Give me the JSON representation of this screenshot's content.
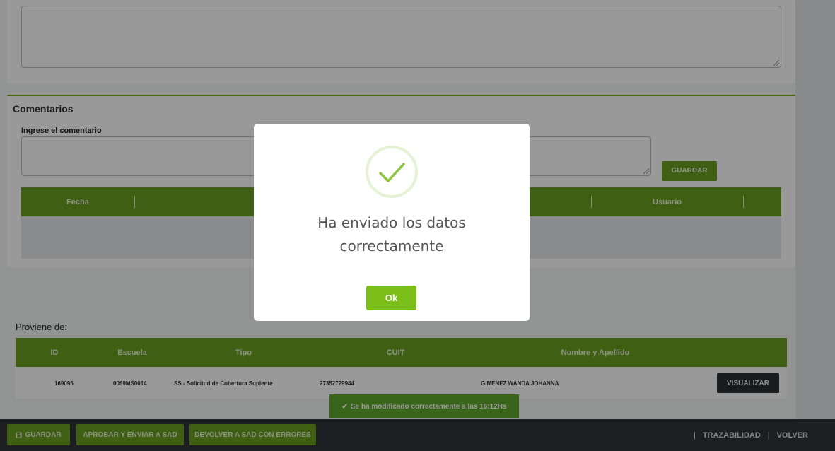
{
  "comments": {
    "title": "Comentarios",
    "input_label": "Ingrese el comentario",
    "save_label": "GUARDAR",
    "columns": [
      "Fecha",
      "Usuario"
    ]
  },
  "origin": {
    "title": "Proviene de:",
    "columns": [
      "ID",
      "Escuela",
      "Tipo",
      "CUIT",
      "Nombre y Apellido"
    ],
    "row": {
      "id": "169095",
      "escuela": "0069MS0014",
      "tipo": "SS - Solicitud de Cobertura Suplente",
      "cuit": "27352729944",
      "nombre": "GIMENEZ WANDA JOHANNA",
      "action": "VISUALIZAR"
    }
  },
  "toast": {
    "icon": "check-icon",
    "text": "Se ha modificado correctamente a las 16:12Hs"
  },
  "bottom_bar": {
    "save_label": "GUARDAR",
    "approve_label": "APROBAR Y ENVIAR A SAD",
    "return_label": "DEVOLVER A SAD CON ERRORES",
    "links": [
      "TRAZABILIDAD",
      "VOLVER"
    ]
  },
  "modal": {
    "icon": "success-check-icon",
    "message": "Ha enviado los datos correctamente",
    "ok_label": "Ok"
  },
  "colors": {
    "accent_green": "#6a9e1f",
    "ok_green": "#7cbf1a",
    "toast_green": "#5fa82c",
    "bar_dark": "#2f3337"
  }
}
